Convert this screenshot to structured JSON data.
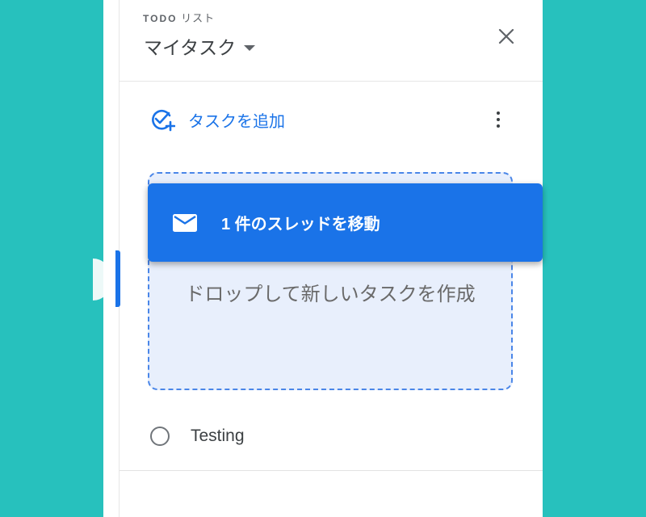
{
  "colors": {
    "background": "#27c1bd",
    "accent": "#1a73e8",
    "drop_zone_fill": "#e8effc",
    "drop_zone_border": "#4a86e8"
  },
  "header": {
    "list_label_prefix": "TODO",
    "list_label_suffix": " リスト",
    "list_title": "マイタスク",
    "dropdown_icon": "caret-down-icon",
    "close_icon": "close-icon"
  },
  "toolbar": {
    "add_task_label": "タスクを追加",
    "add_task_icon": "add-task-icon",
    "more_icon": "more-vert-icon"
  },
  "drag": {
    "chip_label": "1 件のスレッドを移動",
    "chip_icon": "mail-icon",
    "drop_zone_text": "ドロップして新しいタスクを作成"
  },
  "tasks": [
    {
      "title": "Testing",
      "completed": false
    }
  ]
}
